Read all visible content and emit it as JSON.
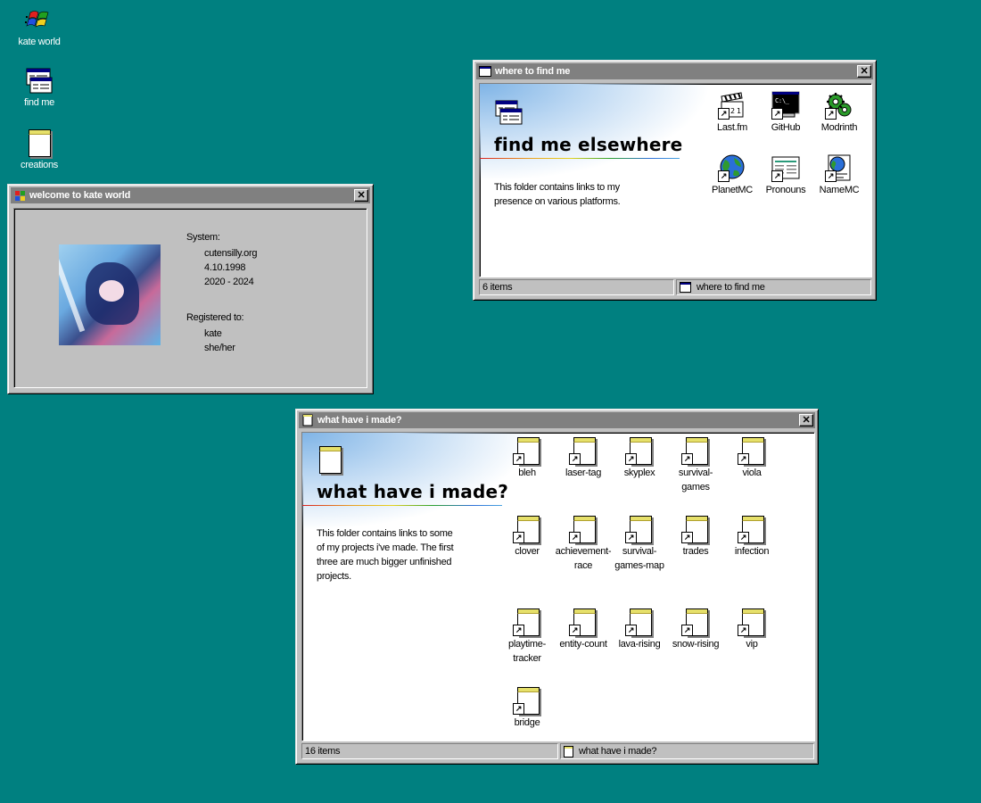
{
  "desktop": {
    "icons": [
      {
        "label": "kate world",
        "icon": "windows-flag-icon"
      },
      {
        "label": "find me",
        "icon": "program-windows-icon"
      },
      {
        "label": "creations",
        "icon": "notepad-icon"
      }
    ]
  },
  "welcome_window": {
    "title": "welcome to kate world",
    "system_label": "System:",
    "system_lines": [
      "cutensilly.org",
      "4.10.1998",
      "2020 - 2024"
    ],
    "registered_label": "Registered to:",
    "registered_lines": [
      "kate",
      "she/her"
    ]
  },
  "findme_window": {
    "title": "where to find me",
    "heading": "find me elsewhere",
    "description": "This folder contains links to my presence on various platforms.",
    "items": [
      {
        "label": "Last.fm",
        "icon": "clapperboard-icon"
      },
      {
        "label": "GitHub",
        "icon": "terminal-icon"
      },
      {
        "label": "Modrinth",
        "icon": "gears-icon"
      },
      {
        "label": "PlanetMC",
        "icon": "globe-icon"
      },
      {
        "label": "Pronouns",
        "icon": "document-icon"
      },
      {
        "label": "NameMC",
        "icon": "web-page-icon"
      }
    ],
    "status_count": "6 items",
    "status_location": "where to find me"
  },
  "made_window": {
    "title": "what have i made?",
    "heading": "what have i made?",
    "description": "This folder contains links to some of my projects i've made. The first three are much bigger unfinished projects.",
    "items": [
      {
        "label": "bleh"
      },
      {
        "label": "laser-tag"
      },
      {
        "label": "skyplex"
      },
      {
        "label": "survival-games"
      },
      {
        "label": "viola"
      },
      {
        "label": "clover"
      },
      {
        "label": "achievement-race"
      },
      {
        "label": "survival-games-map"
      },
      {
        "label": "trades"
      },
      {
        "label": "infection"
      },
      {
        "label": "playtime-tracker"
      },
      {
        "label": "entity-count"
      },
      {
        "label": "lava-rising"
      },
      {
        "label": "snow-rising"
      },
      {
        "label": "vip"
      },
      {
        "label": "bridge"
      }
    ],
    "status_count": "16 items",
    "status_location": "what have i made?"
  },
  "colors": {
    "desktop": "#008080",
    "titlebar_inactive": "#808080",
    "window_face": "#c0c0c0"
  }
}
